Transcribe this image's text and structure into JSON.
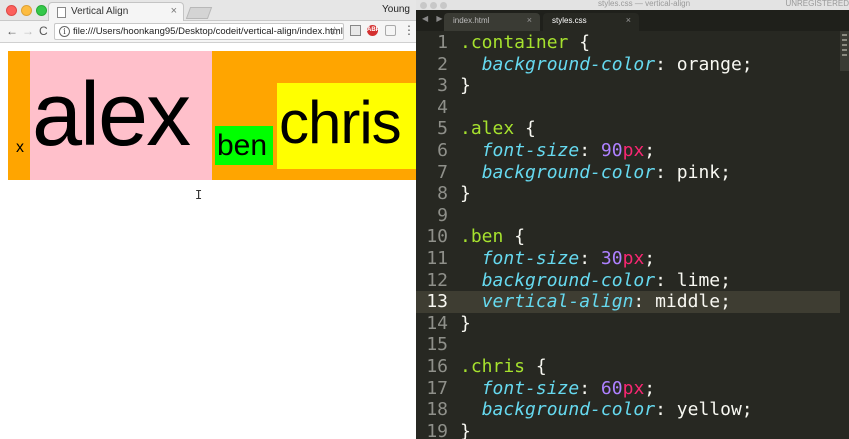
{
  "browser": {
    "tab_title": "Vertical Align",
    "tab_close": "×",
    "profile_name": "Young",
    "url": "file:///Users/hoonkang95/Desktop/codeit/vertical-align/index.html",
    "nav": {
      "back": "←",
      "forward": "→",
      "reload": "C"
    },
    "star": "☆",
    "extension_badge": "ABP",
    "menu": "⋮",
    "info": "i"
  },
  "page": {
    "x_text": "x",
    "alex_text": "alex",
    "ben_text": "ben",
    "chris_text": "chris",
    "colors": {
      "container": "orange",
      "alex": "pink",
      "ben": "lime",
      "chris": "yellow"
    }
  },
  "editor": {
    "window_title": "styles.css — vertical-align",
    "unregistered": "UNREGISTERED",
    "tabs": [
      {
        "label": "index.html",
        "active": false
      },
      {
        "label": "styles.css",
        "active": true
      }
    ],
    "tab_close": "×",
    "highlighted_line": 13,
    "lines": [
      {
        "n": "1",
        "code": ".container {"
      },
      {
        "n": "2",
        "code": "  background-color: orange;"
      },
      {
        "n": "3",
        "code": "}"
      },
      {
        "n": "4",
        "code": ""
      },
      {
        "n": "5",
        "code": ".alex {"
      },
      {
        "n": "6",
        "code": "  font-size: 90px;"
      },
      {
        "n": "7",
        "code": "  background-color: pink;"
      },
      {
        "n": "8",
        "code": "}"
      },
      {
        "n": "9",
        "code": ""
      },
      {
        "n": "10",
        "code": ".ben {"
      },
      {
        "n": "11",
        "code": "  font-size: 30px;"
      },
      {
        "n": "12",
        "code": "  background-color: lime;"
      },
      {
        "n": "13",
        "code": "  vertical-align: middle;"
      },
      {
        "n": "14",
        "code": "}"
      },
      {
        "n": "15",
        "code": ""
      },
      {
        "n": "16",
        "code": ".chris {"
      },
      {
        "n": "17",
        "code": "  font-size: 60px;"
      },
      {
        "n": "18",
        "code": "  background-color: yellow;"
      },
      {
        "n": "19",
        "code": "}"
      }
    ]
  }
}
